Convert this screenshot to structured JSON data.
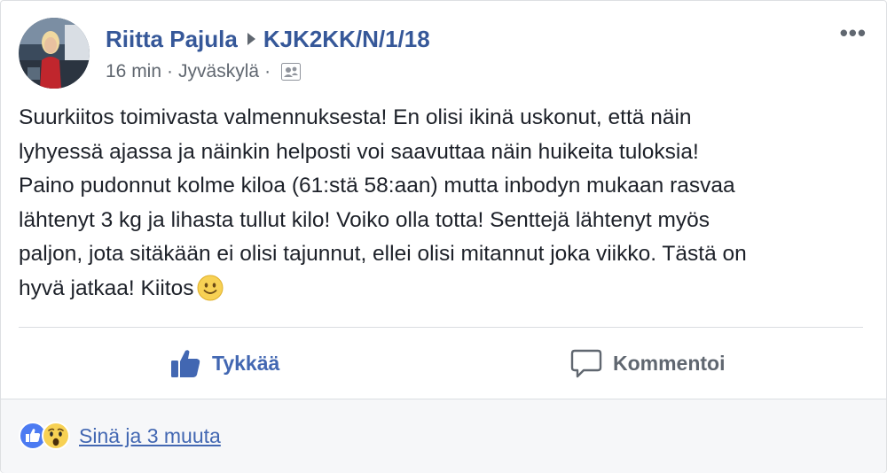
{
  "post": {
    "author": "Riitta Pajula",
    "group": "KJK2KK/N/1/18",
    "time": "16 min",
    "location": "Jyväskylä",
    "separator": "·",
    "more_label": "•••",
    "body_lines": [
      "Suurkiitos toimivasta valmennuksesta! En olisi ikinä uskonut, että näin",
      "lyhyessä ajassa ja näinkin helposti voi saavuttaa näin huikeita tuloksia!",
      "Paino pudonnut kolme kiloa (61:stä 58:aan) mutta inbodyn mukaan rasvaa",
      "lähtenyt 3 kg ja lihasta tullut kilo! Voiko olla totta! Senttejä lähtenyt myös",
      "paljon, jota sitäkään ei olisi tajunnut, ellei olisi mitannut joka viikko. Tästä on",
      "hyvä jatkaa! Kiitos"
    ]
  },
  "actions": {
    "like_label": "Tykkää",
    "comment_label": "Kommentoi"
  },
  "reactions": {
    "summary": "Sinä ja 3 muuta",
    "icons": [
      "like-reaction-icon",
      "wow-reaction-icon"
    ]
  },
  "colors": {
    "link_blue": "#365899",
    "action_blue": "#4267b2",
    "text": "#1d2129",
    "muted": "#606770"
  }
}
